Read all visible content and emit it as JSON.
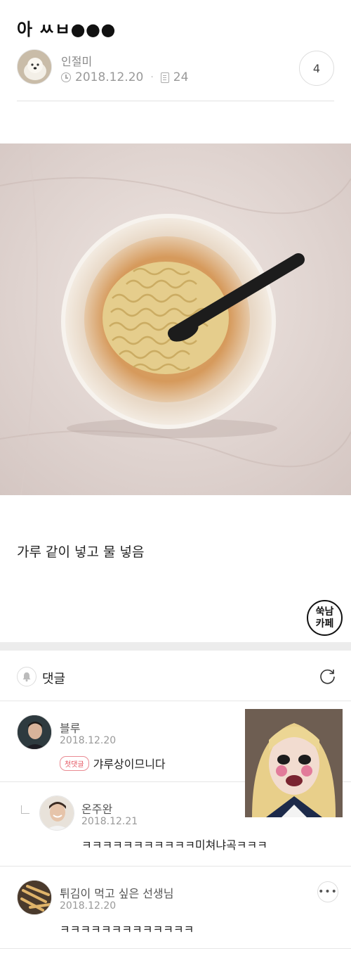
{
  "post": {
    "title": "아 ㅆㅂ●●●",
    "author": "인절미",
    "date": "2018.12.20",
    "views": "24",
    "comment_count": "4",
    "body": "가루 같이 넣고 물 넣음",
    "cafe_logo_line1": "쑥남",
    "cafe_logo_line2": "카페"
  },
  "comments_section": {
    "label": "댓글"
  },
  "comments": [
    {
      "author": "블루",
      "date": "2018.12.20",
      "badge": "첫댓글",
      "text": "갸루상이므니다"
    },
    {
      "author": "온주완",
      "date": "2018.12.21",
      "text": "ㅋㅋㅋㅋㅋㅋㅋㅋㅋㅋㅋ미쳐냐곡ㅋㅋㅋ"
    },
    {
      "author": "튀김이 먹고 싶은 선생님",
      "date": "2018.12.20",
      "text": "ㅋㅋㅋㅋㅋㅋㅋㅋㅋㅋㅋㅋㅋ"
    }
  ],
  "icons": {
    "clock": "clock-icon",
    "views": "document-icon",
    "bell": "bell-icon",
    "refresh": "refresh-icon",
    "reply": "reply-arrow-icon",
    "more": "more-icon"
  },
  "colors": {
    "badge": "#e4525e",
    "divider": "#e6e6e6",
    "section_gap": "#ececec"
  }
}
